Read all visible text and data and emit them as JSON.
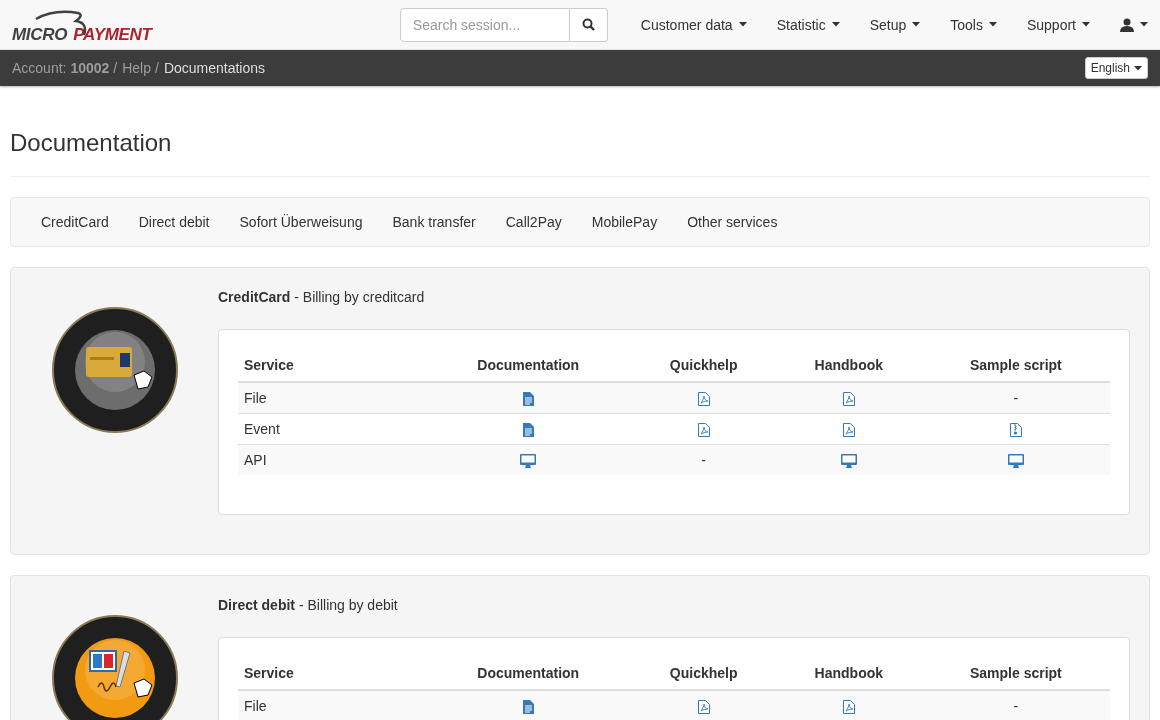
{
  "logo": {
    "left": "MICRO",
    "right": "PAYMENT"
  },
  "search": {
    "placeholder": "Search session..."
  },
  "menu": [
    {
      "label": "Customer data",
      "kind": "text"
    },
    {
      "label": "Statistic",
      "kind": "text"
    },
    {
      "label": "Setup",
      "kind": "text"
    },
    {
      "label": "Tools",
      "kind": "text"
    },
    {
      "label": "Support",
      "kind": "text"
    },
    {
      "kind": "user"
    }
  ],
  "breadcrumb": [
    {
      "kind": "account",
      "label": "Account:",
      "value": "10002",
      "separator": "/"
    },
    {
      "kind": "link",
      "text": "Help",
      "separator": "/"
    },
    {
      "kind": "current",
      "text": "Documentations"
    }
  ],
  "language": "English",
  "title": "Documentation",
  "tabs": [
    {
      "label": "CreditCard"
    },
    {
      "label": "Direct debit"
    },
    {
      "label": "Sofort Überweisung"
    },
    {
      "label": "Bank transfer"
    },
    {
      "label": "Call2Pay"
    },
    {
      "label": "MobilePay"
    },
    {
      "label": "Other services"
    }
  ],
  "sections": [
    {
      "name": "CreditCard",
      "subtitle": " - Billing by creditcard",
      "columns": [
        "Service",
        "Documentation",
        "Quickhelp",
        "Handbook",
        "Sample script"
      ],
      "rows": [
        [
          {
            "kind": "text",
            "text": "File"
          },
          {
            "kind": "doc"
          },
          {
            "kind": "pdf"
          },
          {
            "kind": "pdf"
          },
          {
            "kind": "text",
            "text": "-"
          }
        ],
        [
          {
            "kind": "text",
            "text": "Event"
          },
          {
            "kind": "doc"
          },
          {
            "kind": "pdf"
          },
          {
            "kind": "pdf"
          },
          {
            "kind": "zip"
          }
        ],
        [
          {
            "kind": "text",
            "text": "API"
          },
          {
            "kind": "screen"
          },
          {
            "kind": "text",
            "text": "-"
          },
          {
            "kind": "screen"
          },
          {
            "kind": "screen"
          }
        ]
      ]
    },
    {
      "name": "Direct debit",
      "subtitle": " - Billing by debit",
      "columns": [
        "Service",
        "Documentation",
        "Quickhelp",
        "Handbook",
        "Sample script"
      ],
      "rows": [
        [
          {
            "kind": "text",
            "text": "File"
          },
          {
            "kind": "doc"
          },
          {
            "kind": "pdf"
          },
          {
            "kind": "pdf"
          },
          {
            "kind": "text",
            "text": "-"
          }
        ]
      ]
    }
  ]
}
